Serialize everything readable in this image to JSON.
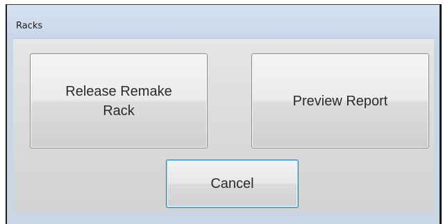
{
  "window": {
    "title": "Racks"
  },
  "buttons": {
    "release_remake_rack": "Release Remake Rack",
    "preview_report": "Preview Report",
    "cancel": "Cancel"
  },
  "colors": {
    "title_bar": "#c9d6e6",
    "client_area": "#dcdcdc",
    "focus_border": "#3c7fb1"
  }
}
